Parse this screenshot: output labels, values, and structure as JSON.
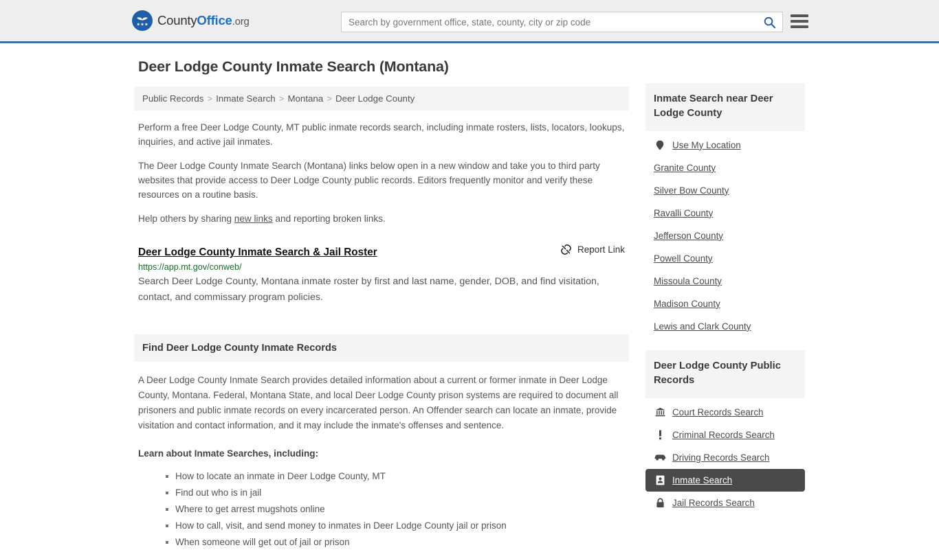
{
  "header": {
    "brand": {
      "part1": "County",
      "part2": "Office",
      "part3": ".org"
    },
    "search": {
      "placeholder": "Search by government office, state, county, city or zip code",
      "value": ""
    },
    "search_icon": "search-icon",
    "menu_icon": "hamburger-menu-icon",
    "accent_color": "#3b74a8"
  },
  "page": {
    "title": "Deer Lodge County Inmate Search (Montana)"
  },
  "breadcrumb": {
    "items": [
      "Public Records",
      "Inmate Search",
      "Montana",
      "Deer Lodge County"
    ],
    "separator": ">"
  },
  "intro": {
    "paragraph1": "Perform a free Deer Lodge County, MT public inmate records search, including inmate rosters, lists, locators, lookups, inquiries, and active jail inmates.",
    "paragraph2": "The Deer Lodge County Inmate Search (Montana) links below open in a new window and take you to third party websites that provide access to Deer Lodge County public records. Editors frequently monitor and verify these resources on a routine basis.",
    "help_prefix": "Help others by sharing ",
    "help_link": "new links",
    "help_suffix": " and reporting broken links."
  },
  "result": {
    "title": "Deer Lodge County Inmate Search & Jail Roster",
    "report_label": "Report Link",
    "report_icon": "broken-link-icon",
    "url": "https://app.mt.gov/conweb/",
    "url_color": "#1d6b2e",
    "description": "Search Deer Lodge County, Montana inmate roster by first and last name, gender, DOB, and find visitation, contact, and commissary program policies."
  },
  "section": {
    "heading": "Find Deer Lodge County Inmate Records",
    "body": "A Deer Lodge County Inmate Search provides detailed information about a current or former inmate in Deer Lodge County, Montana. Federal, Montana State, and local Deer Lodge County prison systems are required to document all prisoners and public inmate records on every incarcerated person. An Offender search can locate an inmate, provide visitation and contact information, and it may include the inmate's offenses and sentence.",
    "learn_heading": "Learn about Inmate Searches, including:",
    "learn_items": [
      "How to locate an inmate in Deer Lodge County, MT",
      "Find out who is in jail",
      "Where to get arrest mugshots online",
      "How to call, visit, and send money to inmates in Deer Lodge County jail or prison",
      "When someone will get out of jail or prison"
    ]
  },
  "sidebar": {
    "nearby": {
      "title": "Inmate Search near Deer Lodge County",
      "items": [
        {
          "label": "Use My Location",
          "icon": "map-pin-icon"
        },
        {
          "label": "Granite County",
          "icon": ""
        },
        {
          "label": "Silver Bow County",
          "icon": ""
        },
        {
          "label": "Ravalli County",
          "icon": ""
        },
        {
          "label": "Jefferson County",
          "icon": ""
        },
        {
          "label": "Powell County",
          "icon": ""
        },
        {
          "label": "Missoula County",
          "icon": ""
        },
        {
          "label": "Madison County",
          "icon": ""
        },
        {
          "label": "Lewis and Clark County",
          "icon": ""
        }
      ]
    },
    "records": {
      "title": "Deer Lodge County Public Records",
      "active_color": "#4a4a4a",
      "items": [
        {
          "label": "Court Records Search",
          "icon": "courthouse-icon",
          "active": false
        },
        {
          "label": "Criminal Records Search",
          "icon": "exclamation-icon",
          "active": false
        },
        {
          "label": "Driving Records Search",
          "icon": "car-icon",
          "active": false
        },
        {
          "label": "Inmate Search",
          "icon": "id-card-icon",
          "active": true
        },
        {
          "label": "Jail Records Search",
          "icon": "lock-icon",
          "active": false
        }
      ]
    }
  }
}
